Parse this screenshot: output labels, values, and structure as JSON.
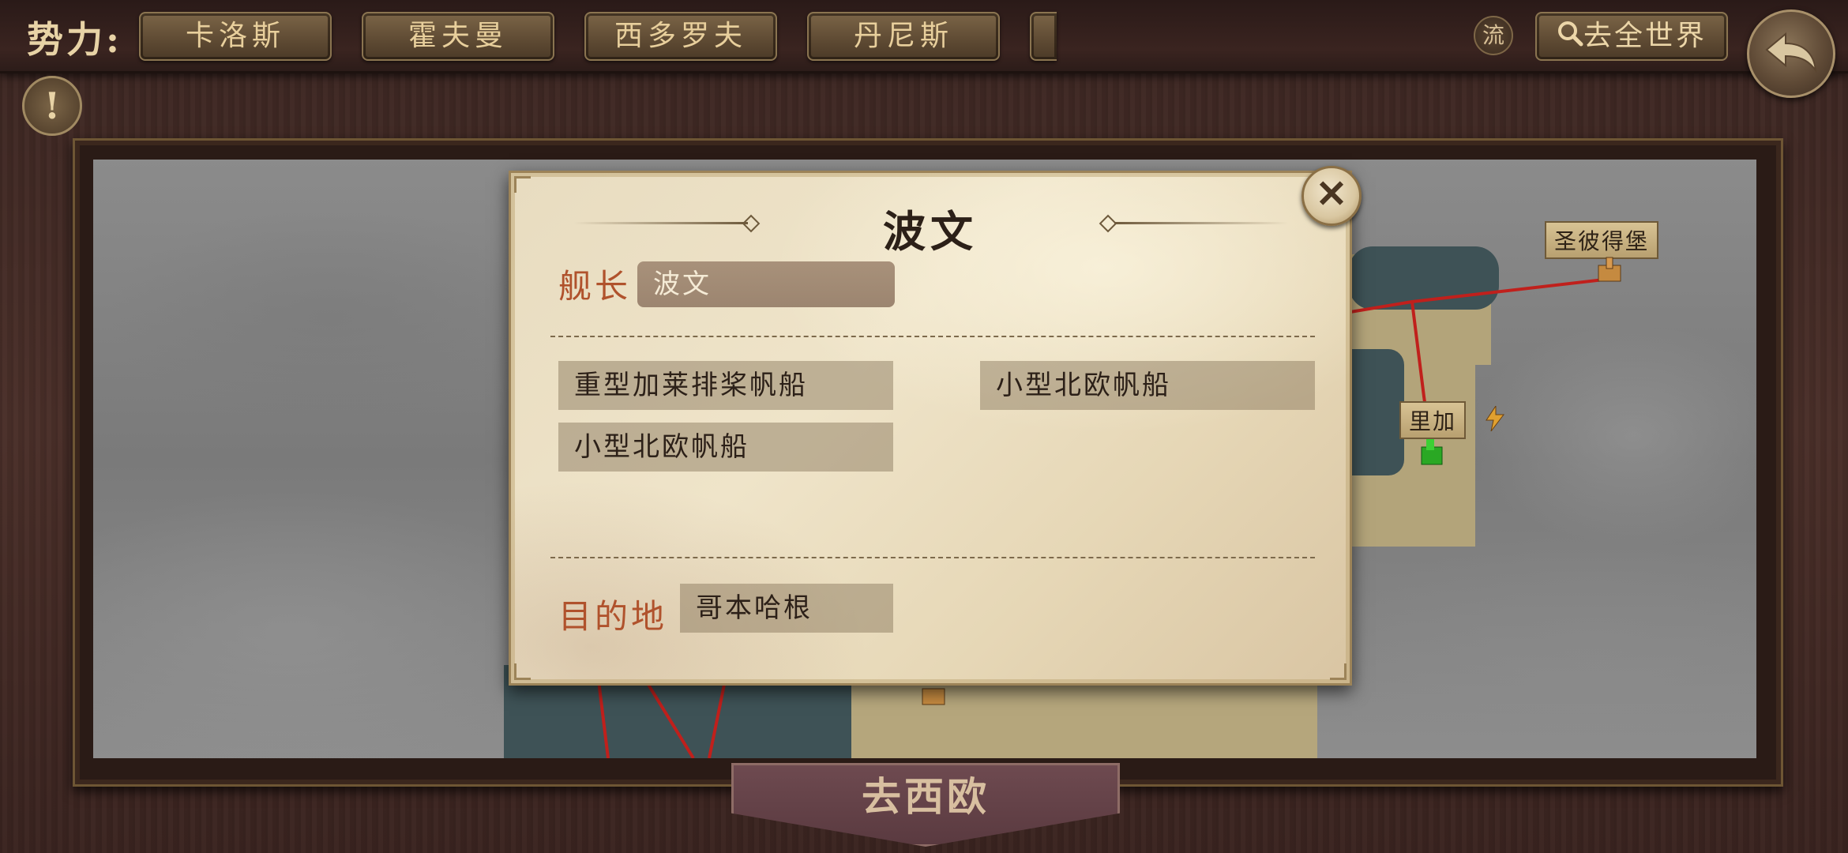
{
  "topbar": {
    "faction_label": "势力:",
    "factions": [
      "卡洛斯",
      "霍夫曼",
      "西多罗夫",
      "丹尼斯"
    ],
    "flow_label": "流",
    "search_label": "去全世界",
    "info_label": "!"
  },
  "map": {
    "cities": [
      "圣彼得堡",
      "里加"
    ],
    "go_region_label": "去西欧"
  },
  "dialog": {
    "title": "波文",
    "captain_label": "舰长",
    "captain_value": "波文",
    "ships": [
      "重型加莱排桨帆船",
      "小型北欧帆船",
      "小型北欧帆船"
    ],
    "destination_label": "目的地",
    "destination_value": "哥本哈根"
  },
  "colors": {
    "accent_red": "#b0522c",
    "route_red": "#c0201c",
    "parchment": "#efe4c9"
  }
}
